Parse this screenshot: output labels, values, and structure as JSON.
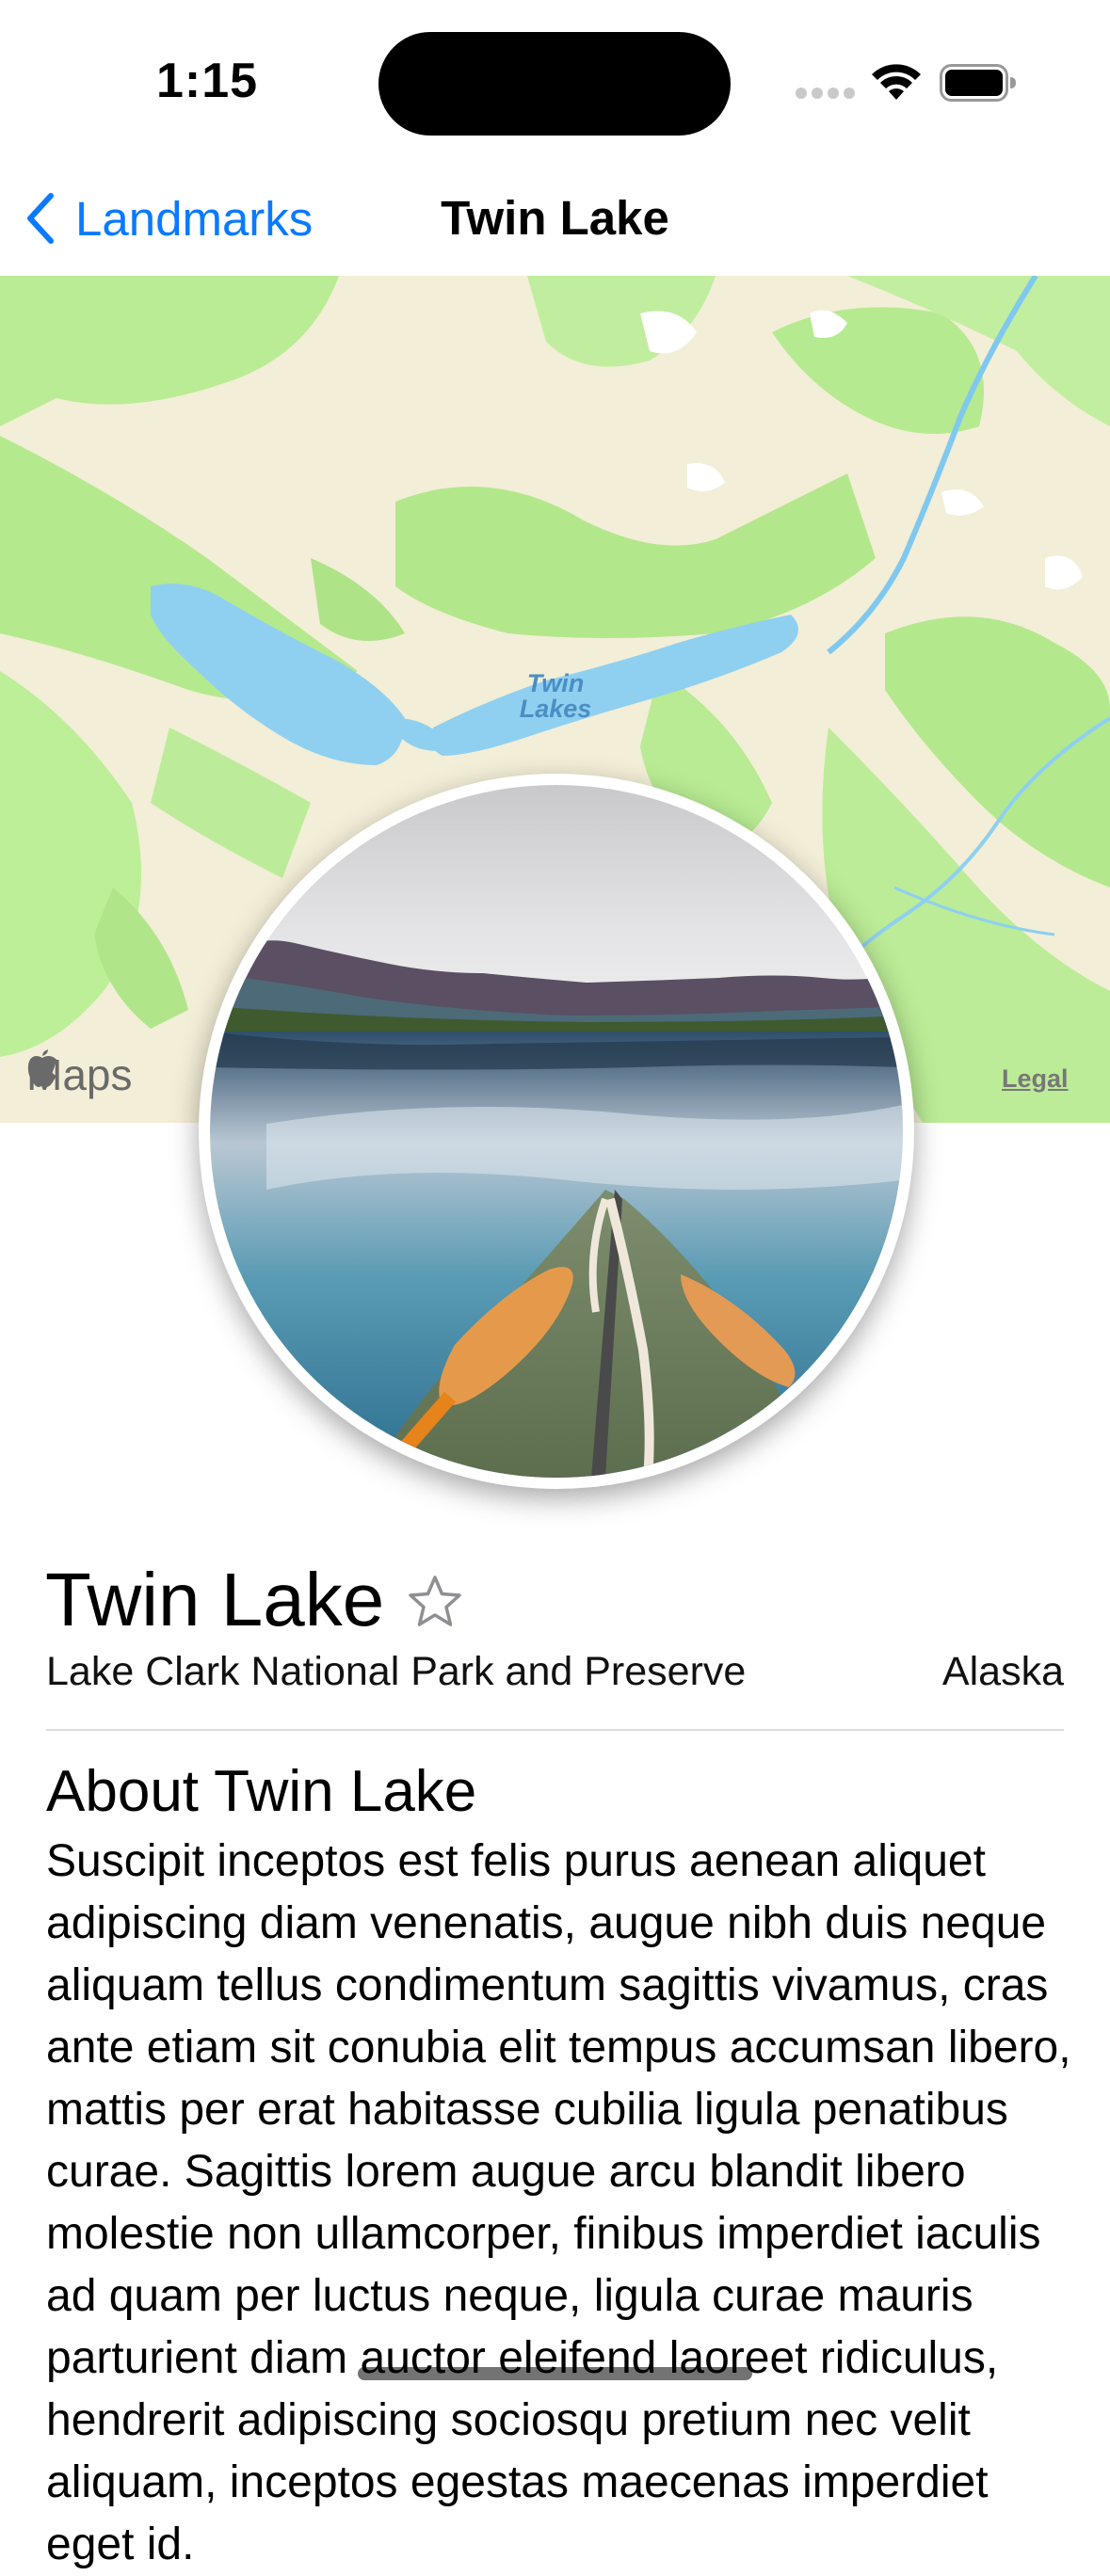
{
  "status_bar": {
    "time": "1:15"
  },
  "nav": {
    "back_label": "Landmarks",
    "title": "Twin Lake"
  },
  "map": {
    "brand": "Maps",
    "legal": "Legal",
    "label_line1": "Twin",
    "label_line2": "Lakes"
  },
  "landmark": {
    "name": "Twin Lake",
    "favorite": false,
    "park": "Lake Clark National Park and Preserve",
    "state": "Alaska",
    "about_title": "About Twin Lake",
    "description": "Suscipit inceptos est felis purus aenean aliquet adipiscing diam venenatis, augue nibh duis neque aliquam tellus condimentum sagittis vivamus, cras ante etiam sit conubia elit tempus accumsan libero, mattis per erat habitasse cubilia ligula penatibus curae. Sagittis lorem augue arcu blandit libero molestie non ullamcorper, finibus imperdiet iaculis ad quam per luctus neque, ligula curae mauris parturient diam auctor eleifend laoreet ridiculus, hendrerit adipiscing sociosqu pretium nec velit aliquam, inceptos egestas maecenas imperdiet eget id."
  },
  "colors": {
    "accent": "#0a7aff",
    "water": "#8fd0f0",
    "forest": "#b7eb8f"
  },
  "icons": [
    "chevron-left-icon",
    "star-outline-icon",
    "apple-logo-icon",
    "wifi-icon",
    "battery-icon",
    "signal-icon"
  ]
}
